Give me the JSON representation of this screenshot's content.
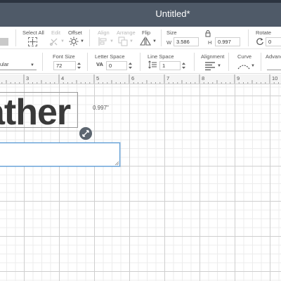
{
  "window": {
    "title": "Untitled*"
  },
  "toolbar1": {
    "select_all": "Select All",
    "edit": "Edit",
    "offset": "Offset",
    "align": "Align",
    "arrange": "Arrange",
    "flip": "Flip",
    "size": {
      "label": "Size",
      "w_label": "W",
      "w_value": "3.586",
      "h_label": "H",
      "h_value": "0.997"
    },
    "rotate": {
      "label": "Rotate",
      "value": "0"
    }
  },
  "toolbar2": {
    "font_style_value": "ular",
    "font_size": {
      "label": "Font Size",
      "value": "72"
    },
    "letter_space": {
      "label": "Letter Space",
      "icon_text": "VA",
      "value": "0"
    },
    "line_space": {
      "label": "Line Space",
      "value": "1"
    },
    "alignment": {
      "label": "Alignment"
    },
    "curve": {
      "label": "Curve"
    },
    "advanced": {
      "label": "Advanc"
    }
  },
  "ruler": {
    "numbers": [
      "3",
      "4",
      "5",
      "6",
      "7",
      "8",
      "9",
      "10"
    ]
  },
  "canvas": {
    "text": "ather",
    "height_label": "0.997\"",
    "text_box_value": ""
  },
  "icons": {
    "select_all": "select-all-icon",
    "edit": "edit-icon",
    "offset": "offset-icon",
    "align": "align-icon",
    "arrange": "arrange-icon",
    "flip": "flip-icon",
    "lock": "lock-icon",
    "rotate": "rotate-icon",
    "line_space": "line-space-icon",
    "alignment": "text-align-icon",
    "curve": "curve-icon",
    "resize": "resize-icon"
  },
  "colors": {
    "titlebar": "#4f5a68",
    "selection": "#5b9bd5",
    "handle": "#5d6670"
  }
}
